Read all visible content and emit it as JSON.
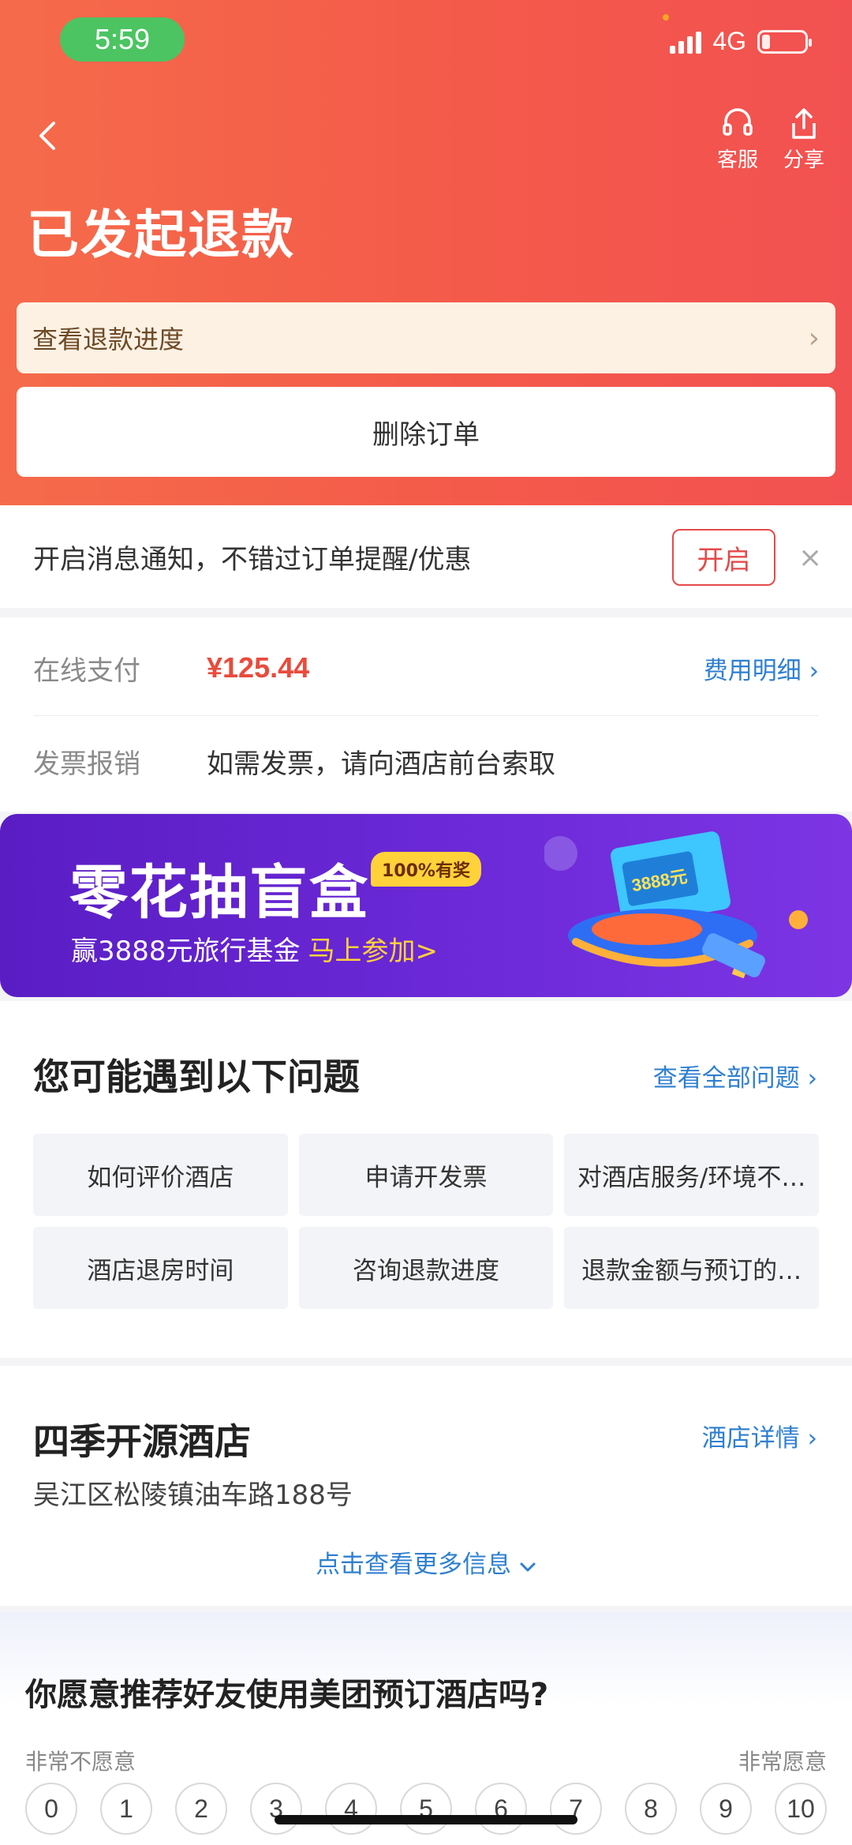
{
  "status_bar": {
    "time": "5:59",
    "network": "4G"
  },
  "header": {
    "title": "已发起退款",
    "service_label": "客服",
    "share_label": "分享"
  },
  "refund_progress": {
    "label": "查看退款进度"
  },
  "delete_order": {
    "label": "删除订单"
  },
  "notification": {
    "text": "开启消息通知，不错过订单提醒/优惠",
    "button": "开启",
    "close": "×"
  },
  "payment": {
    "label": "在线支付",
    "amount": "¥125.44",
    "detail_link": "费用明细",
    "invoice_label": "发票报销",
    "invoice_text": "如需发票，请向酒店前台索取"
  },
  "banner": {
    "title": "零花抽盲盒",
    "badge": "100%有奖",
    "subtitle": "赢3888元旅行基金",
    "cta": "马上参加>",
    "ticket_text": "3888元"
  },
  "faq": {
    "title": "您可能遇到以下问题",
    "all_link": "查看全部问题",
    "questions": [
      "如何评价酒店",
      "申请开发票",
      "对酒店服务/环境不…",
      "酒店退房时间",
      "咨询退款进度",
      "退款金额与预订的…"
    ]
  },
  "hotel": {
    "name": "四季开源酒店",
    "detail_link": "酒店详情",
    "address": "吴江区松陵镇油车路188号",
    "more": "点击查看更多信息"
  },
  "survey": {
    "question": "你愿意推荐好友使用美团预订酒店吗?",
    "low_label": "非常不愿意",
    "high_label": "非常愿意",
    "scale": [
      "0",
      "1",
      "2",
      "3",
      "4",
      "5",
      "6",
      "7",
      "8",
      "9",
      "10"
    ]
  },
  "colors": {
    "header": "#f45a4a",
    "accent_red": "#e94b3c",
    "link_blue": "#2f7fd0",
    "banner_purple": "#6a28d6",
    "status_green": "#4cc462"
  }
}
